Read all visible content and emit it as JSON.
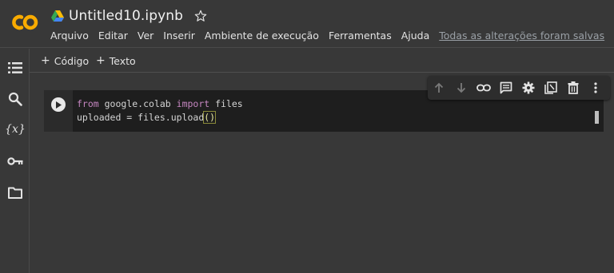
{
  "logo": {
    "text": "CO",
    "color": "#f9ab00"
  },
  "notebook": {
    "title": "Untitled10.ipynb"
  },
  "menu": {
    "items": [
      "Arquivo",
      "Editar",
      "Ver",
      "Inserir",
      "Ambiente de execução",
      "Ferramentas",
      "Ajuda"
    ],
    "saved_status": "Todas as alterações foram salvas"
  },
  "sidebar": {
    "icons": [
      "table-of-contents-icon",
      "search-icon",
      "variables-icon",
      "secrets-key-icon",
      "files-folder-icon"
    ],
    "variables_label": "{x}"
  },
  "toolbar": {
    "add_code_label": "Código",
    "add_text_label": "Texto"
  },
  "cell": {
    "line1": {
      "kw1": "from",
      "mid": " google.colab ",
      "kw2": "import",
      "end": " files"
    },
    "line2": {
      "pre": "uploaded = files.upload",
      "paren": "()"
    }
  },
  "cell_toolbar": {
    "icons": [
      "move-up-icon",
      "move-down-icon",
      "link-icon",
      "comment-icon",
      "settings-icon",
      "mirror-cell-icon",
      "delete-icon",
      "more-icon"
    ]
  },
  "colors": {
    "background": "#383838",
    "editor": "#1e1e1e",
    "keyword": "#c586c0",
    "logo_accent": "#f9ab00"
  }
}
